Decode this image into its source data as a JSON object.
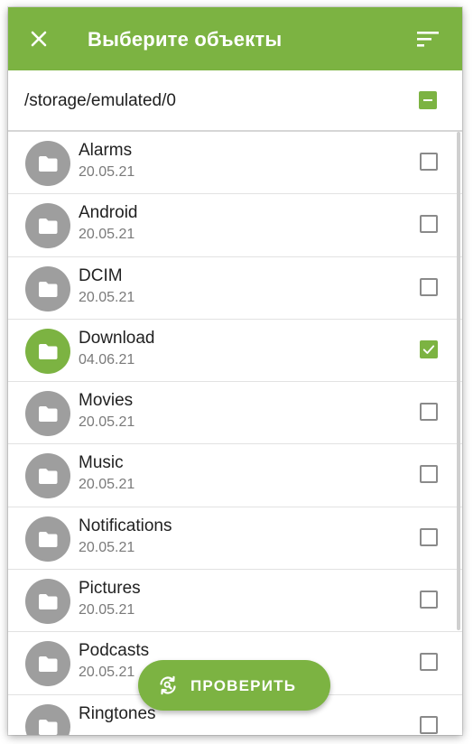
{
  "colors": {
    "accent": "#7cb342",
    "folder_icon_default": "#9e9e9e",
    "text_primary": "#212121",
    "text_secondary": "#7a7a7a"
  },
  "appbar": {
    "title": "Выберите объекты",
    "close_icon": "close-icon",
    "sort_icon": "sort-icon"
  },
  "path_bar": {
    "path": "/storage/emulated/0",
    "select_all_state": "indeterminate"
  },
  "items": [
    {
      "name": "Alarms",
      "date": "20.05.21",
      "checked": false
    },
    {
      "name": "Android",
      "date": "20.05.21",
      "checked": false
    },
    {
      "name": "DCIM",
      "date": "20.05.21",
      "checked": false
    },
    {
      "name": "Download",
      "date": "04.06.21",
      "checked": true
    },
    {
      "name": "Movies",
      "date": "20.05.21",
      "checked": false
    },
    {
      "name": "Music",
      "date": "20.05.21",
      "checked": false
    },
    {
      "name": "Notifications",
      "date": "20.05.21",
      "checked": false
    },
    {
      "name": "Pictures",
      "date": "20.05.21",
      "checked": false
    },
    {
      "name": "Podcasts",
      "date": "20.05.21",
      "checked": false
    },
    {
      "name": "Ringtones",
      "date": "",
      "checked": false
    }
  ],
  "fab": {
    "label": "ПРОВЕРИТЬ",
    "icon": "scan-icon"
  }
}
